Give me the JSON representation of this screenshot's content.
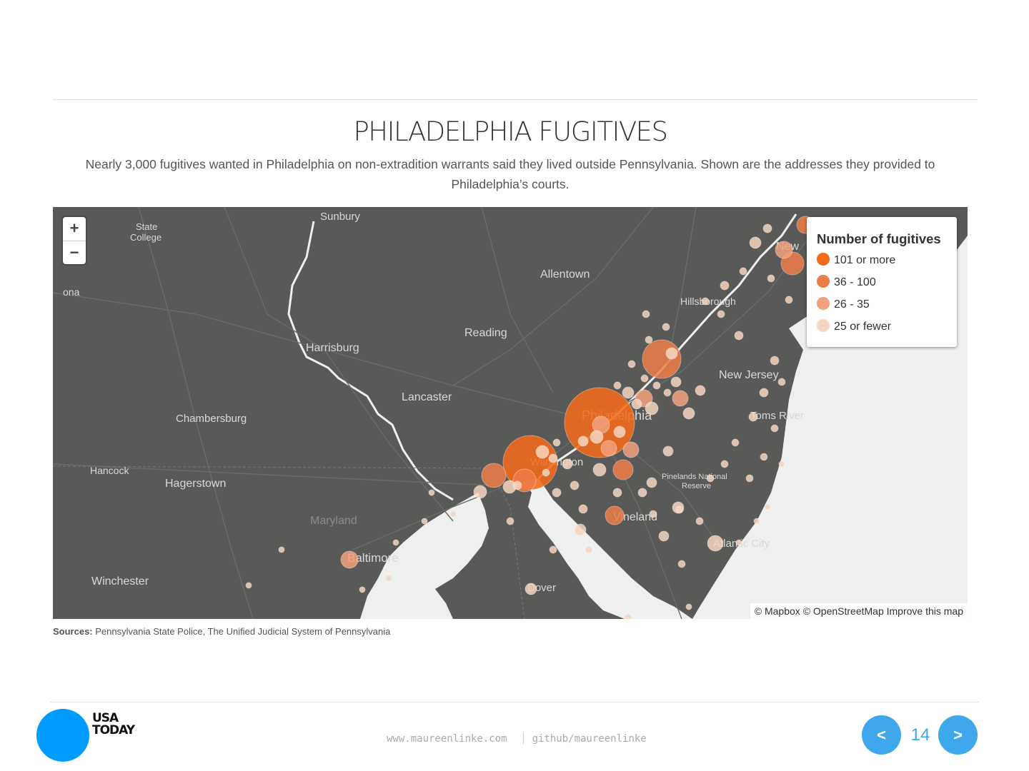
{
  "title": "PHILADELPHIA FUGITIVES",
  "subtitle": "Nearly 3,000 fugitives wanted in Philadelphia on non-extradition warrants said they lived outside Pennsylvania. Shown are the addresses they provided to Philadelphia’s courts.",
  "map": {
    "zoom_in": "+",
    "zoom_out": "−",
    "attribution": {
      "mapbox": "© Mapbox",
      "osm": "© OpenStreetMap",
      "improve": "Improve this map"
    },
    "place_labels": [
      "State College",
      "Sunbury",
      "Allentown",
      "Altoona",
      "Hillsborough",
      "Reading",
      "Harrisburg",
      "New Jersey",
      "Lancaster",
      "Chambersburg",
      "Philadelphia",
      "Toms River",
      "Hancock",
      "Hagerstown",
      "Wilmington",
      "Pinelands National Reserve",
      "Maryland",
      "Vineland",
      "Atlantic City",
      "Baltimore",
      "Winchester",
      "Dover",
      "New York"
    ],
    "legend": {
      "title": "Number of fugitives",
      "items": [
        {
          "label": "101 or more",
          "color": "#f26a1b"
        },
        {
          "label": "36 - 100",
          "color": "#ee7d48"
        },
        {
          "label": "26 - 35",
          "color": "#f2a07c"
        },
        {
          "label": "25 or fewer",
          "color": "#f6d5c0"
        }
      ]
    },
    "colors": {
      "land": "#595a58",
      "water": "#eef0f0",
      "roads": "#6a6b69"
    }
  },
  "sources": {
    "label": "Sources:",
    "text": "Pennsylvania State Police, The Unified Judicial System of Pennsylvania"
  },
  "footer": {
    "site": "www.maureenlinke.com",
    "github": "github/maureenlinke",
    "logo_line1": "USA",
    "logo_line2": "TODAY",
    "page": "14",
    "prev": "<",
    "next": ">"
  }
}
